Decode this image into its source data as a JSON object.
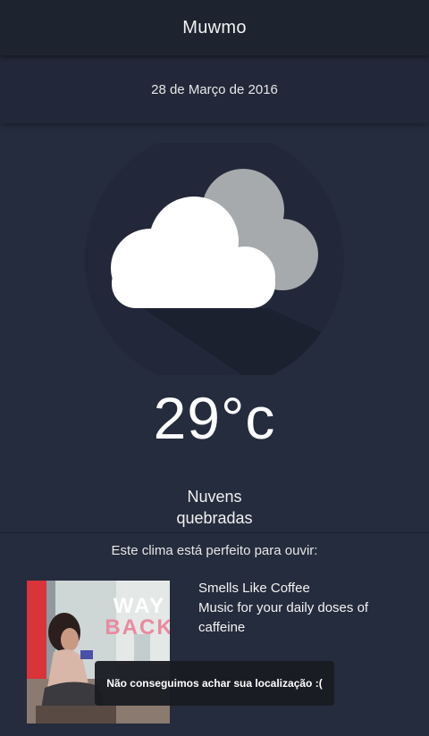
{
  "app": {
    "title": "Muwmo"
  },
  "date": "28 de Março de 2016",
  "weather": {
    "icon": "broken-clouds-icon",
    "temperature": "29°c",
    "condition_line1": "Nuvens",
    "condition_line2": "quebradas"
  },
  "music": {
    "prompt": "Este clima está perfeito para ouvir:",
    "playlist_title": "Smells Like Coffee",
    "playlist_description": "Music for your daily doses of caffeine",
    "album_art_text_line1": "WAY",
    "album_art_text_line2": "BACK"
  },
  "toast": {
    "message": "Não conseguimos achar sua localização :("
  },
  "colors": {
    "background": "#252c3d",
    "appbar": "#1e2330",
    "cloud_front": "#ffffff",
    "cloud_back": "#a7aaac",
    "icon_circle": "#222839",
    "accent_pink": "#e88aa0"
  }
}
